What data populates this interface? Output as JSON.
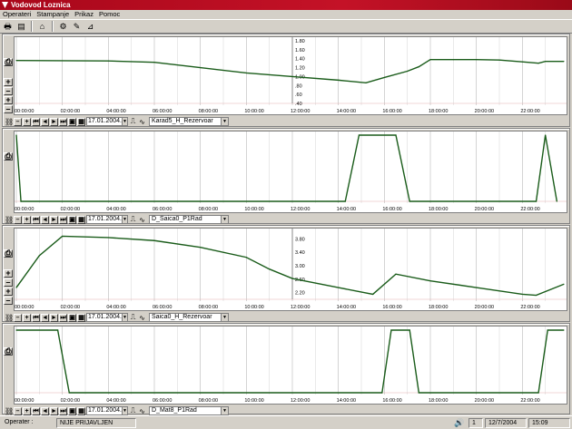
{
  "window": {
    "title": "Vodovod Loznica"
  },
  "menu": [
    "Operateri",
    "Stampanje",
    "Prikaz",
    "Pomoc"
  ],
  "toolbar": {
    "icons": [
      "printer-icon",
      "preview-icon",
      "home-icon",
      "settings-icon",
      "tools-icon",
      "chart-icon"
    ]
  },
  "time_axis": {
    "labels": [
      "00:00:00",
      "02:00:00",
      "04:00:00",
      "06:00:00",
      "08:00:00",
      "10:00:00",
      "12:00:00",
      "14:00:00",
      "16:00:00",
      "18:00:00",
      "20:00:00",
      "22:00:00"
    ]
  },
  "panels": [
    {
      "date": "17.01.2004.",
      "tag": "Karad5_H_Rezervoar",
      "y_ticks": [
        "1.80",
        "1.60",
        "1.40",
        "1.20",
        "1.00",
        ".80",
        ".60",
        ".40"
      ]
    },
    {
      "date": "17.01.2004.",
      "tag": "D_Saica0_P1Rad",
      "y_ticks": []
    },
    {
      "date": "17.01.2004.",
      "tag": "Saica0_H_Rezervoar",
      "y_ticks": [
        "3.80",
        "3.40",
        "3.00",
        "2.60",
        "2.20"
      ]
    },
    {
      "date": "17.01.2004.",
      "tag": "D_Mat8_P1Rad",
      "y_ticks": []
    }
  ],
  "chart_data": [
    {
      "type": "line",
      "series": [
        {
          "x": [
            0,
            4,
            6,
            8,
            10,
            12,
            14,
            15.2,
            16,
            17,
            17.5,
            18,
            19,
            20,
            21,
            22,
            22.7,
            23,
            23.8
          ],
          "y": [
            1.36,
            1.35,
            1.32,
            1.2,
            1.08,
            1.0,
            0.92,
            0.86,
            0.98,
            1.12,
            1.22,
            1.38,
            1.38,
            1.38,
            1.37,
            1.33,
            1.3,
            1.34,
            1.34
          ]
        }
      ],
      "ylim": [
        0.4,
        1.8
      ]
    },
    {
      "type": "line",
      "series": [
        {
          "x": [
            0,
            0.2,
            14.3,
            14.9,
            16.5,
            17.1,
            22.6,
            23,
            23.5
          ],
          "y": [
            1,
            0,
            0,
            1,
            1,
            0,
            0,
            1,
            0
          ]
        }
      ],
      "ylim": [
        0,
        1
      ]
    },
    {
      "type": "line",
      "series": [
        {
          "x": [
            0,
            1,
            2,
            4,
            6,
            8,
            10,
            11,
            12,
            14,
            15.5,
            16.5,
            18,
            20,
            22,
            22.6,
            23.8
          ],
          "y": [
            2.35,
            3.3,
            3.88,
            3.84,
            3.75,
            3.55,
            3.25,
            2.9,
            2.62,
            2.35,
            2.15,
            2.75,
            2.55,
            2.35,
            2.15,
            2.12,
            2.45
          ]
        }
      ],
      "ylim": [
        2.0,
        4.0
      ]
    },
    {
      "type": "line",
      "series": [
        {
          "x": [
            0,
            1.8,
            2.3,
            15.9,
            16.3,
            17.1,
            17.5,
            22.7,
            23.1,
            23.8
          ],
          "y": [
            1,
            1,
            0,
            0,
            1,
            1,
            0,
            0,
            1,
            1
          ]
        }
      ],
      "ylim": [
        0,
        1
      ]
    }
  ],
  "status": {
    "operater_label": "Operater :",
    "operater_value": "NIJE PRIJAVLJEN",
    "count": "1",
    "date": "12/7/2004",
    "time": "15:09"
  },
  "colors": {
    "line": "#1a5c1a",
    "grid": "#c9c9c9",
    "title_bar": "#b20d1f"
  }
}
